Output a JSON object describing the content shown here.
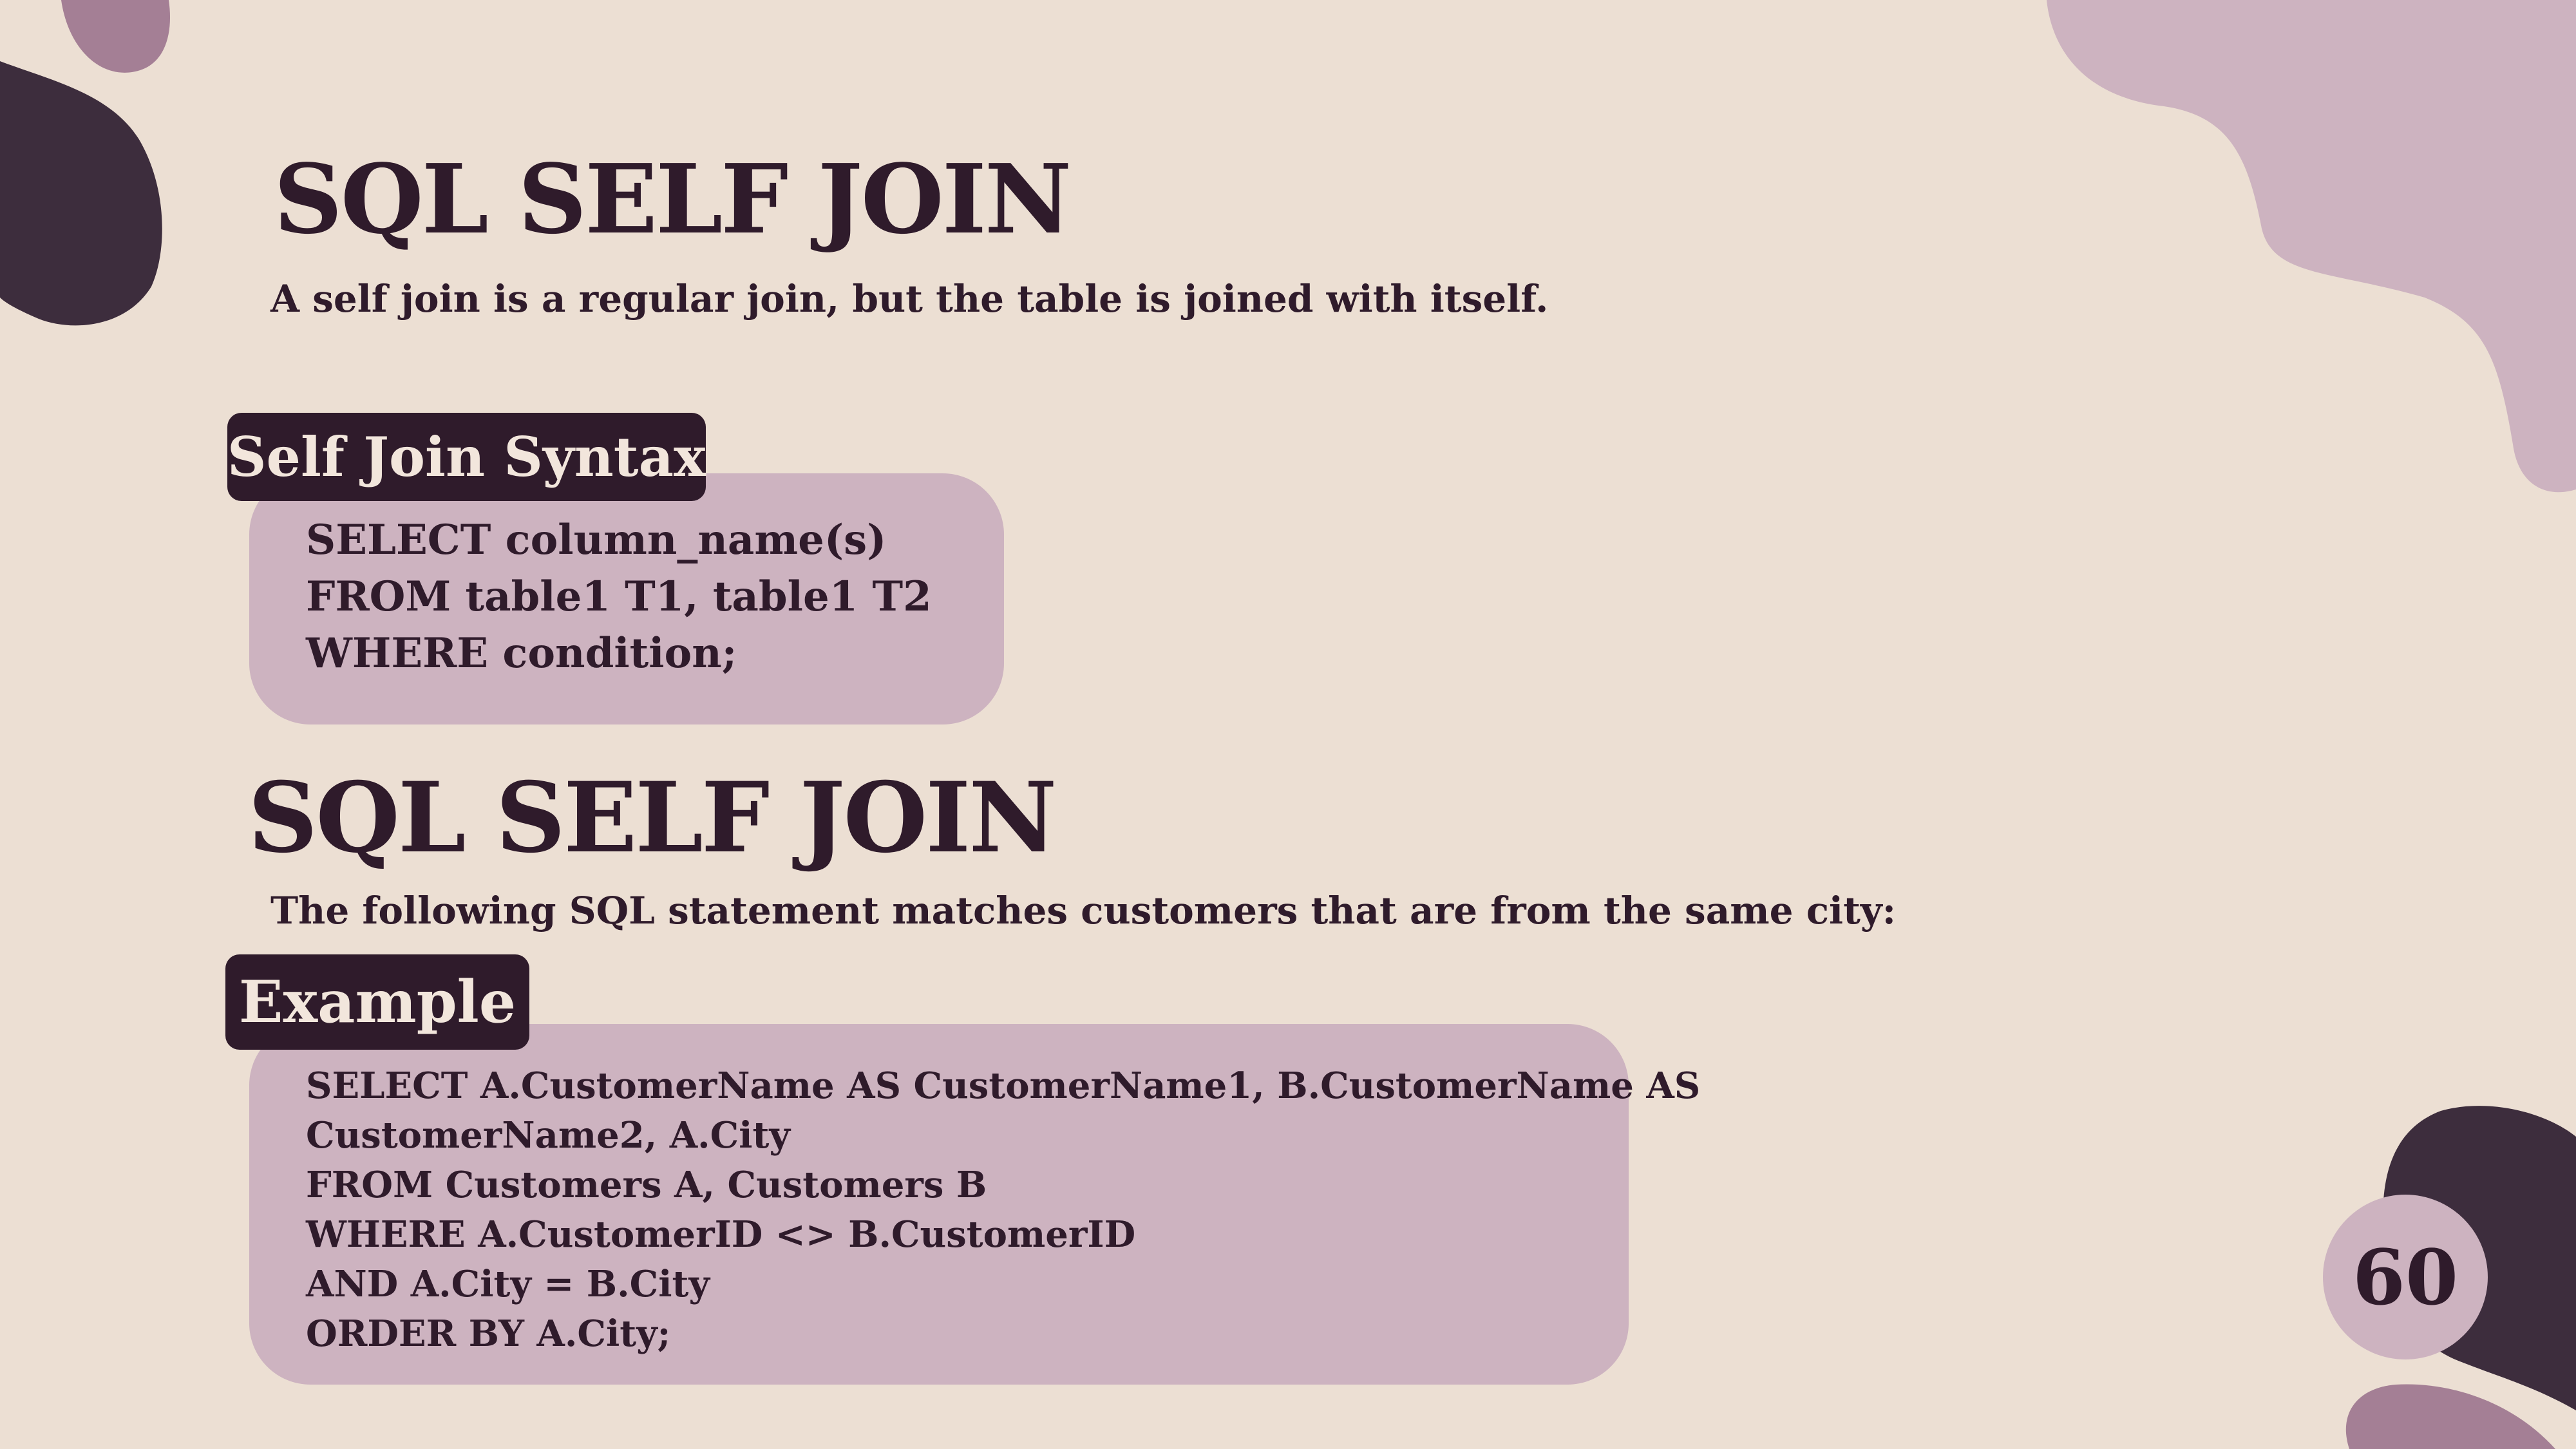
{
  "slide": {
    "title_1": "SQL SELF JOIN",
    "description_1": "A self join is a regular join, but the table is joined with itself.",
    "syntax_label": "Self Join Syntax",
    "syntax_lines": [
      "SELECT column_name(s)",
      "FROM table1 T1, table1 T2",
      "WHERE condition;"
    ],
    "title_2": "SQL SELF JOIN",
    "description_2": "The following SQL statement matches customers that are from the same city:",
    "example_label": "Example",
    "example_lines": [
      "SELECT A.CustomerName AS CustomerName1, B.CustomerName AS",
      "CustomerName2, A.City",
      "FROM Customers A, Customers B",
      "WHERE A.CustomerID <> B.CustomerID",
      "AND A.City = B.City",
      "ORDER BY A.City;"
    ],
    "page_number": "60"
  },
  "colors": {
    "background": "#ecdfd3",
    "dark_plum": "#3d2d3d",
    "mauve": "#a47f95",
    "light_mauve": "#cdb3c0",
    "text": "#2f1b2b"
  }
}
